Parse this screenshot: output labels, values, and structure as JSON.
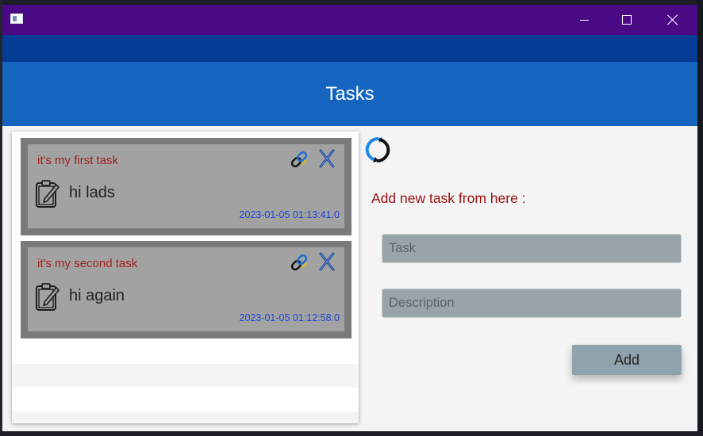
{
  "header": {
    "title": "Tasks"
  },
  "tasks": [
    {
      "title": "it's my first task",
      "description": "hi lads",
      "date": "2023-01-05 01:13:41.0"
    },
    {
      "title": "it's my second task",
      "description": "hi again",
      "date": "2023-01-05 01:12:58.0"
    }
  ],
  "form": {
    "label": "Add new task from here :",
    "task_placeholder": "Task",
    "description_placeholder": "Description",
    "add_label": "Add"
  },
  "icons": {
    "refresh": "refresh-icon",
    "edit": "clipboard-edit-icon",
    "link": "link-icon",
    "delete": "tools-icon"
  },
  "colors": {
    "titlebar": "#4a0a85",
    "menubar": "#033d96",
    "header": "#1565c0",
    "task_title": "#a32020",
    "task_date": "#2245d6",
    "form_label": "#9c0f0f"
  }
}
